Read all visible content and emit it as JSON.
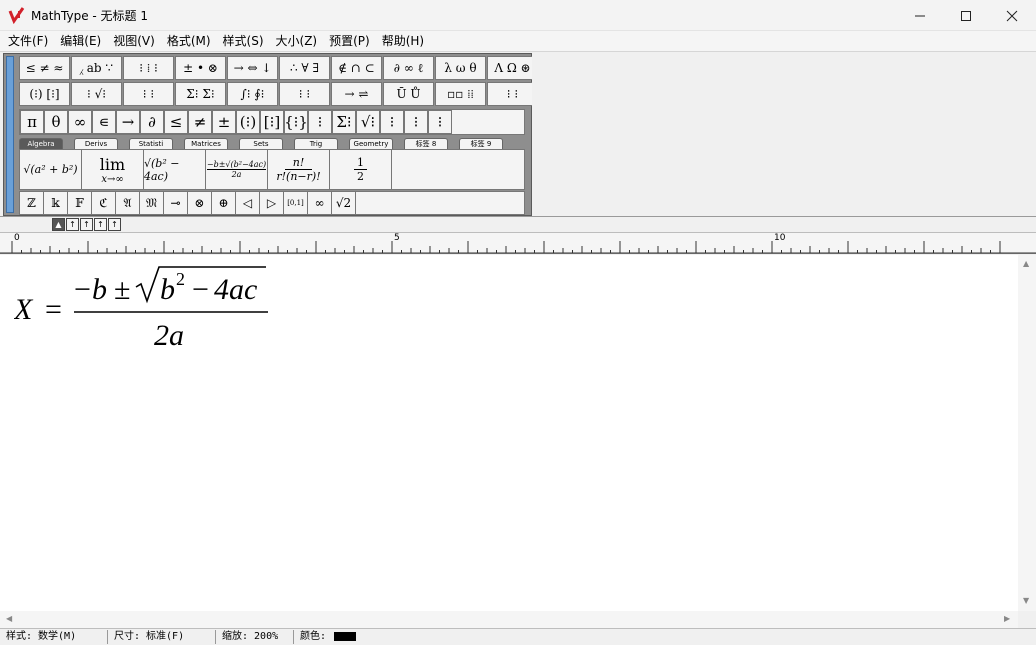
{
  "window": {
    "title": "MathType - 无标题 1",
    "min_icon": "minimize-icon",
    "max_icon": "maximize-icon",
    "close_icon": "close-icon"
  },
  "menu": [
    "文件(F)",
    "编辑(E)",
    "视图(V)",
    "格式(M)",
    "样式(S)",
    "大小(Z)",
    "预置(P)",
    "帮助(H)"
  ],
  "palette_row1": [
    "≤ ≠ ≈",
    "⁁ ab ∵",
    "⁝ ⁞ ⁝",
    "± • ⊗",
    "→ ⇔ ↓",
    "∴ ∀ ∃",
    "∉ ∩ ⊂",
    "∂ ∞ ℓ",
    "λ ω θ",
    "Λ Ω ⊛"
  ],
  "palette_row2": [
    "(⁝) [⁝]",
    "⁝ √⁝",
    "⁝ ⁝",
    "Σ⁝ Σ⁝",
    "∫⁝ ∮⁝",
    "⁝ ⁝",
    "→ ⇌",
    "Ū Ů",
    "▫▫ ⁞⁞",
    "⁝ ⁝"
  ],
  "palette_row3": [
    "π",
    "θ",
    "∞",
    "∊",
    "→",
    "∂",
    "≤",
    "≠",
    "±",
    "(⁝)",
    "[⁝]",
    "{⁝}",
    "⁝",
    "Σ⁝",
    "√⁝",
    "⁝",
    "⁝",
    "⁝"
  ],
  "tabs": [
    "Algebra",
    "Derivs",
    "Statisti",
    "Matrices",
    "Sets",
    "Trig",
    "Geometry",
    "标签 8",
    "标签 9"
  ],
  "templates": {
    "t1": "√(a² + b²)",
    "t2_top": "lim",
    "t2_bottom": "x→∞",
    "t3": "√(b² − 4ac)",
    "t4_top": "−b±√(b²−4ac)",
    "t4_bottom": "2a",
    "t5_top": "n!",
    "t5_bottom": "r!(n−r)!",
    "t6_top": "1",
    "t6_bottom": "2"
  },
  "palette_row5": [
    "ℤ",
    "𝕜",
    "𝔽",
    "ℭ",
    "𝔄",
    "𝔐",
    "⊸",
    "⊗",
    "⊕",
    "◁",
    "▷",
    "[0,1]",
    "∞",
    "√2"
  ],
  "ruler_labels": [
    "0",
    "5",
    "10"
  ],
  "equation": {
    "lhs": "X",
    "equals": "=",
    "numerator_minus": "−",
    "numerator_b": "b",
    "plus_minus": "±",
    "radicand_b": "b",
    "exponent": "2",
    "minus": "−",
    "four_ac": "4ac",
    "denominator": "2a"
  },
  "status": {
    "style": "样式: 数学(M)",
    "size": "尺寸: 标准(F)",
    "zoom": "缩放: 200%",
    "color_label": "颜色:",
    "color_value": "#000000"
  }
}
